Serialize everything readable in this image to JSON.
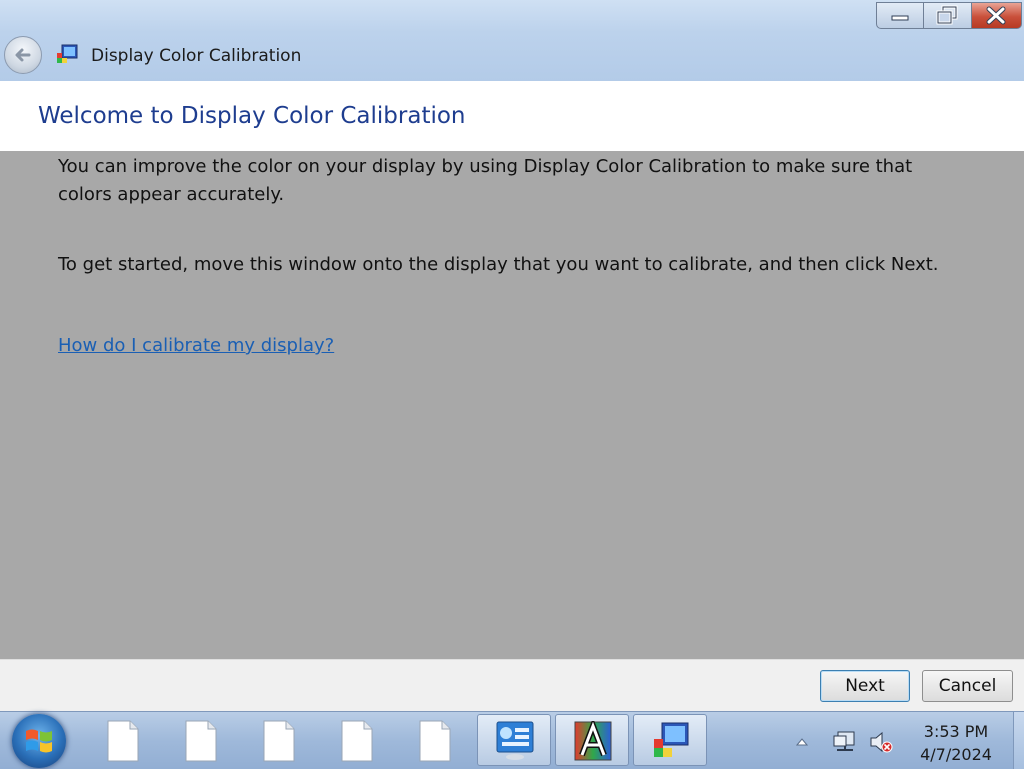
{
  "window": {
    "title": "Display Color Calibration",
    "icons": {
      "back": "back-arrow-icon",
      "app": "display-color-calibration-icon"
    },
    "controls": {
      "minimize": "minimize-icon",
      "maximize": "restore-icon",
      "close": "close-icon"
    }
  },
  "header": {
    "title": "Welcome to Display Color Calibration"
  },
  "content": {
    "paragraph1": "You can improve the color on your display by using Display Color Calibration to make sure that colors appear accurately.",
    "paragraph2": "To get started, move this window onto the display that you want to calibrate, and then click Next.",
    "help_link": "How do I calibrate my display?"
  },
  "footer": {
    "next_label": "Next",
    "cancel_label": "Cancel"
  },
  "taskbar": {
    "start_icon": "windows-start-icon",
    "pinned": [
      "file-icon",
      "file-icon",
      "file-icon",
      "file-icon",
      "file-icon"
    ],
    "apps": [
      "control-panel-icon",
      "font-viewer-icon",
      "display-color-calibration-icon"
    ],
    "tray": {
      "expand": "tray-expand-icon",
      "network": "network-icon",
      "volume": "volume-muted-icon"
    },
    "clock": {
      "time": "3:53 PM",
      "date": "4/7/2024"
    }
  },
  "colors": {
    "title_blue": "#1e3d8f",
    "link_blue": "#1a5fb4",
    "content_gray": "#a8a8a8"
  }
}
